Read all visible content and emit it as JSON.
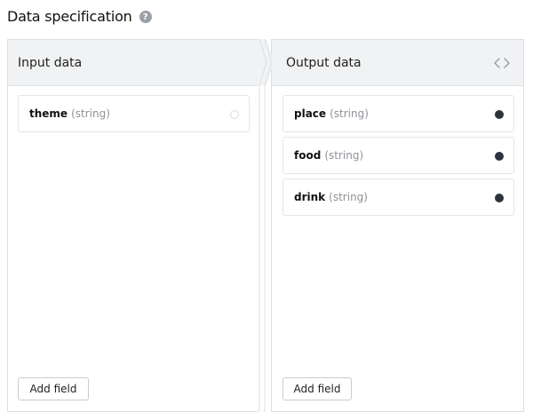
{
  "page": {
    "title": "Data specification",
    "help_icon": "question-circle-icon",
    "help_glyph": "?"
  },
  "input_panel": {
    "header": "Input data",
    "fields": [
      {
        "name": "theme",
        "type": "(string)",
        "connected": false
      }
    ],
    "add_button": "Add field"
  },
  "output_panel": {
    "header": "Output data",
    "header_icon": "code-brackets-icon",
    "fields": [
      {
        "name": "place",
        "type": "(string)",
        "connected": true
      },
      {
        "name": "food",
        "type": "(string)",
        "connected": true
      },
      {
        "name": "drink",
        "type": "(string)",
        "connected": true
      }
    ],
    "add_button": "Add field"
  },
  "colors": {
    "header_bg": "#f1f2f3",
    "border": "#dcdfe2",
    "dot_filled": "#2d3440",
    "type_text": "#8e9297"
  }
}
